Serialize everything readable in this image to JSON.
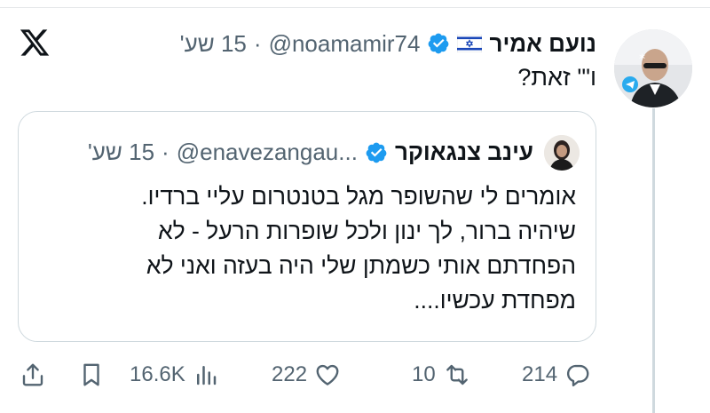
{
  "brand": {
    "icon": "x-logo-icon"
  },
  "tweet": {
    "display_name": "נועם אמיר",
    "flag_icon": "israel-flag-icon",
    "verified_icon": "verified-badge-icon",
    "handle": "@noamamir74",
    "separator": "·",
    "time": "15 שע'",
    "text": "ו\"' זאת?",
    "avatar_icon": "avatar"
  },
  "quote": {
    "display_name": "עינב צנגאוקר",
    "verified_icon": "verified-badge-icon",
    "handle": "@enavezangau...",
    "separator": "·",
    "time": "15 שע'",
    "lines": [
      "אומרים לי שהשופר מגל בטנטרום עליי ברדיו.",
      "שיהיה ברור, לך ינון ולכל שופרות הרעל - לא",
      "הפחדתם אותי כשמתן שלי היה בעזה ואני לא",
      "מפחדת עכשיו...."
    ]
  },
  "actions": {
    "views": "16.6K",
    "likes": "222",
    "retweets": "10",
    "replies": "214"
  },
  "colors": {
    "text": "#0f1419",
    "secondary": "#536471",
    "verified_blue": "#1d9bf0",
    "border": "#cfd9de"
  }
}
